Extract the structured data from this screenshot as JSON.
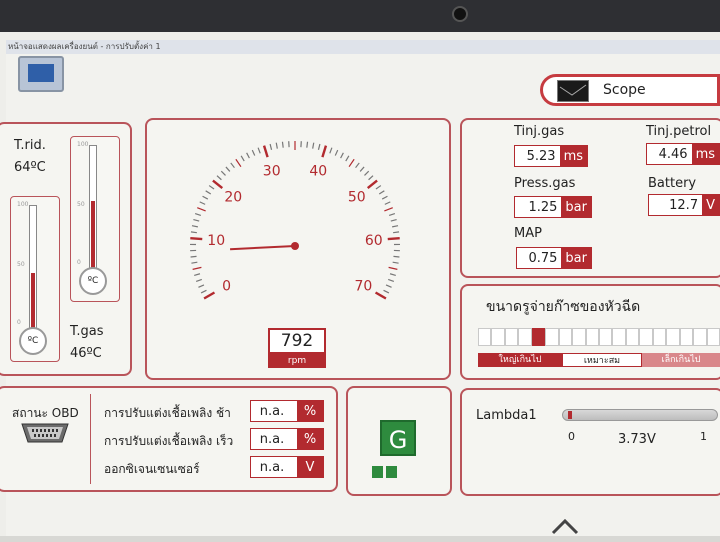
{
  "window": {
    "title": "หน้าจอแสดงผลเครื่องยนต์ - การปรับตั้งค่า 1"
  },
  "scope": {
    "label": "Scope"
  },
  "temps": {
    "t_rid": {
      "label": "T.rid.",
      "value": "64ºC",
      "level": 0.45
    },
    "t_gas": {
      "label": "T.gas",
      "value": "46ºC",
      "level": 0.55
    },
    "unit_glyph": "ºC",
    "ticks": [
      "100",
      "50",
      "0"
    ]
  },
  "gauge": {
    "scale": [
      "0",
      "10",
      "20",
      "30",
      "40",
      "50",
      "60",
      "70"
    ],
    "value": "792",
    "unit": "rpm",
    "needle_thousands": 0.792
  },
  "readings": {
    "tinj_gas": {
      "label": "Tinj.gas",
      "value": "5.23",
      "unit": "ms"
    },
    "press_gas": {
      "label": "Press.gas",
      "value": "1.25",
      "unit": "bar"
    },
    "map": {
      "label": "MAP",
      "value": "0.75",
      "unit": "bar"
    },
    "tinj_petrol": {
      "label": "Tinj.petrol",
      "value": "4.46",
      "unit": "ms"
    },
    "battery": {
      "label": "Battery",
      "value": "12.7",
      "unit": "V"
    }
  },
  "nozzle": {
    "title": "ขนาดรูจ่ายก๊าซของหัวฉีด",
    "segments": 18,
    "marker_index": 4,
    "legend": [
      "ใหญ่เกินไป",
      "เหมาะสม",
      "เล็กเกินไป"
    ]
  },
  "obd": {
    "label": "สถานะ OBD",
    "rows": [
      {
        "label": "การปรับแต่งเชื้อเพลิง ช้า",
        "value": "n.a.",
        "unit": "%"
      },
      {
        "label": "การปรับแต่งเชื้อเพลิง เร็ว",
        "value": "n.a.",
        "unit": "%"
      },
      {
        "label": "ออกซิเจนเซนเซอร์",
        "value": "n.a.",
        "unit": "V"
      }
    ]
  },
  "status": {
    "badge": "G"
  },
  "lambda": {
    "label": "Lambda1",
    "min": "0",
    "max": "1",
    "value": "3.73V"
  },
  "colors": {
    "accent": "#b22a2f",
    "status_green": "#2e8b3e"
  }
}
